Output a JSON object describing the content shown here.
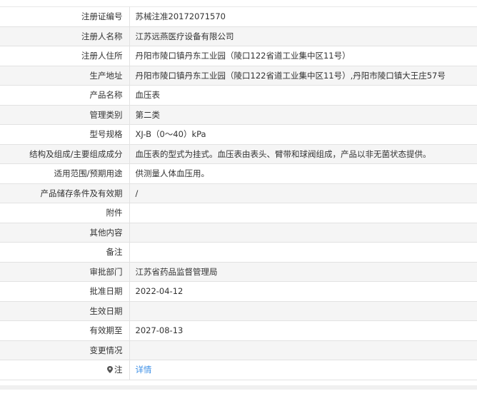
{
  "rows": [
    {
      "label": "注册证编号",
      "value": "苏械注准20172071570"
    },
    {
      "label": "注册人名称",
      "value": "江苏远燕医疗设备有限公司"
    },
    {
      "label": "注册人住所",
      "value": "丹阳市陵口镇丹东工业园（陵口122省道工业集中区11号）"
    },
    {
      "label": "生产地址",
      "value": "丹阳市陵口镇丹东工业园（陵口122省道工业集中区11号）,丹阳市陵口镇大王庄57号"
    },
    {
      "label": "产品名称",
      "value": "血压表"
    },
    {
      "label": "管理类别",
      "value": "第二类"
    },
    {
      "label": "型号规格",
      "value": "XJ-B（0～40）kPa"
    },
    {
      "label": "结构及组成/主要组成成分",
      "value": "血压表的型式为挂式。血压表由表头、臂带和球阀组成，产品以非无菌状态提供。"
    },
    {
      "label": "适用范围/预期用途",
      "value": "供测量人体血压用。"
    },
    {
      "label": "产品储存条件及有效期",
      "value": "/"
    },
    {
      "label": "附件",
      "value": ""
    },
    {
      "label": "其他内容",
      "value": ""
    },
    {
      "label": "备注",
      "value": ""
    },
    {
      "label": "审批部门",
      "value": "江苏省药品监督管理局"
    },
    {
      "label": "批准日期",
      "value": "2022-04-12"
    },
    {
      "label": "生效日期",
      "value": ""
    },
    {
      "label": "有效期至",
      "value": "2027-08-13"
    },
    {
      "label": "变更情况",
      "value": ""
    }
  ],
  "note": {
    "label": "注",
    "icon": "map-pin-icon",
    "link_text": "详情",
    "link_color": "#3a8ee6"
  }
}
